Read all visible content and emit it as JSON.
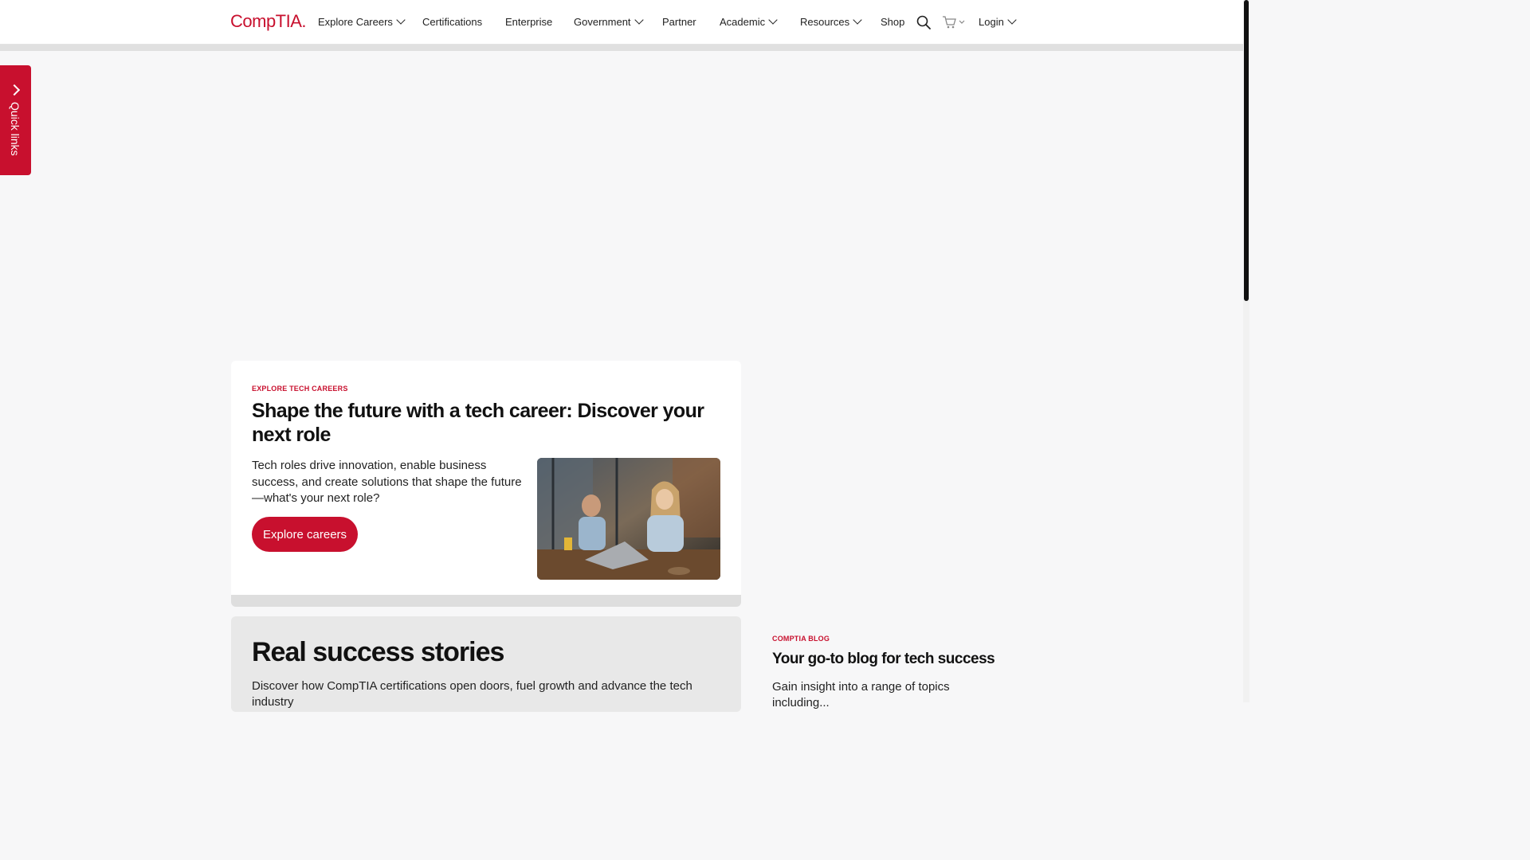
{
  "header": {
    "logo": "CompTIA.",
    "nav": [
      {
        "label": "Explore Careers",
        "dropdown": true
      },
      {
        "label": "Certifications",
        "dropdown": false
      },
      {
        "label": "Enterprise",
        "dropdown": false
      },
      {
        "label": "Government",
        "dropdown": true
      },
      {
        "label": "Partner",
        "dropdown": false
      },
      {
        "label": "Academic",
        "dropdown": true
      },
      {
        "label": "Resources",
        "dropdown": true
      },
      {
        "label": "Shop",
        "dropdown": false
      }
    ],
    "login": "Login",
    "icons": {
      "search": "search-icon",
      "cart": "cart-icon"
    }
  },
  "quick_links": {
    "label": "Quick links"
  },
  "careers_card": {
    "eyebrow": "EXPLORE TECH CAREERS",
    "title": "Shape the future with a tech career: Discover your next role",
    "body": "Tech roles drive innovation, enable business success, and create solutions that shape the future—what's your next role?",
    "button": "Explore careers"
  },
  "stories_card": {
    "title": "Real success stories",
    "body": "Discover how CompTIA certifications open doors, fuel growth and advance the tech industry"
  },
  "blog": {
    "eyebrow": "COMPTIA BLOG",
    "title": "Your go-to blog for tech success",
    "body": "Gain insight into a range of topics including..."
  },
  "colors": {
    "brand": "#c8102e",
    "page_bg": "#f7f7f8"
  }
}
